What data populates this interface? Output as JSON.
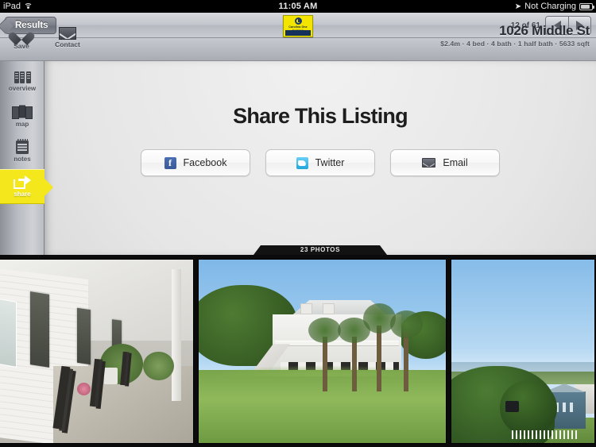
{
  "statusbar": {
    "device": "iPad",
    "wifi_icon": "wifi-icon",
    "time": "11:05 AM",
    "location_icon": "location-arrow-icon",
    "charging_status": "Not Charging",
    "battery_icon": "battery-icon"
  },
  "navbar": {
    "back_label": "Results",
    "logo": {
      "name": "Carolina One",
      "tagline": "Real Estate"
    },
    "pager_label": "12 of 61",
    "prev_icon": "chevron-left-icon",
    "next_icon": "chevron-right-icon"
  },
  "toolbar": {
    "save_label": "Save",
    "save_icon": "heart-icon",
    "contact_label": "Contact",
    "contact_icon": "envelope-icon"
  },
  "listing": {
    "address": "1026 Middle St",
    "details": "$2.4m  ·  4 bed  ·  4 bath  ·  1 half bath  ·  5633 sqft",
    "price": "$2.4m",
    "beds": "4 bed",
    "baths": "4 bath",
    "half_baths": "1 half bath",
    "area": "5633 sqft"
  },
  "sidebar": {
    "items": [
      {
        "label": "overview",
        "icon": "overview-icon",
        "active": false
      },
      {
        "label": "map",
        "icon": "map-icon",
        "active": false
      },
      {
        "label": "notes",
        "icon": "notes-icon",
        "active": false
      },
      {
        "label": "share",
        "icon": "share-icon",
        "active": true
      }
    ],
    "active_color": "#f4e81c"
  },
  "main": {
    "title": "Share This Listing",
    "buttons": [
      {
        "label": "Facebook",
        "icon": "facebook-icon",
        "color": "#3b5998"
      },
      {
        "label": "Twitter",
        "icon": "twitter-icon",
        "color": "#21a6da"
      },
      {
        "label": "Email",
        "icon": "email-icon",
        "color": "#4a4d55"
      }
    ]
  },
  "photos": {
    "tab_label": "23 PHOTOS",
    "count": 23,
    "items": [
      {
        "alt": "front porch with black rocking chairs and white shutters"
      },
      {
        "alt": "white elevated beach house with palm trees and lawn"
      },
      {
        "alt": "elevated view of marsh, trees and a blue house"
      }
    ]
  }
}
